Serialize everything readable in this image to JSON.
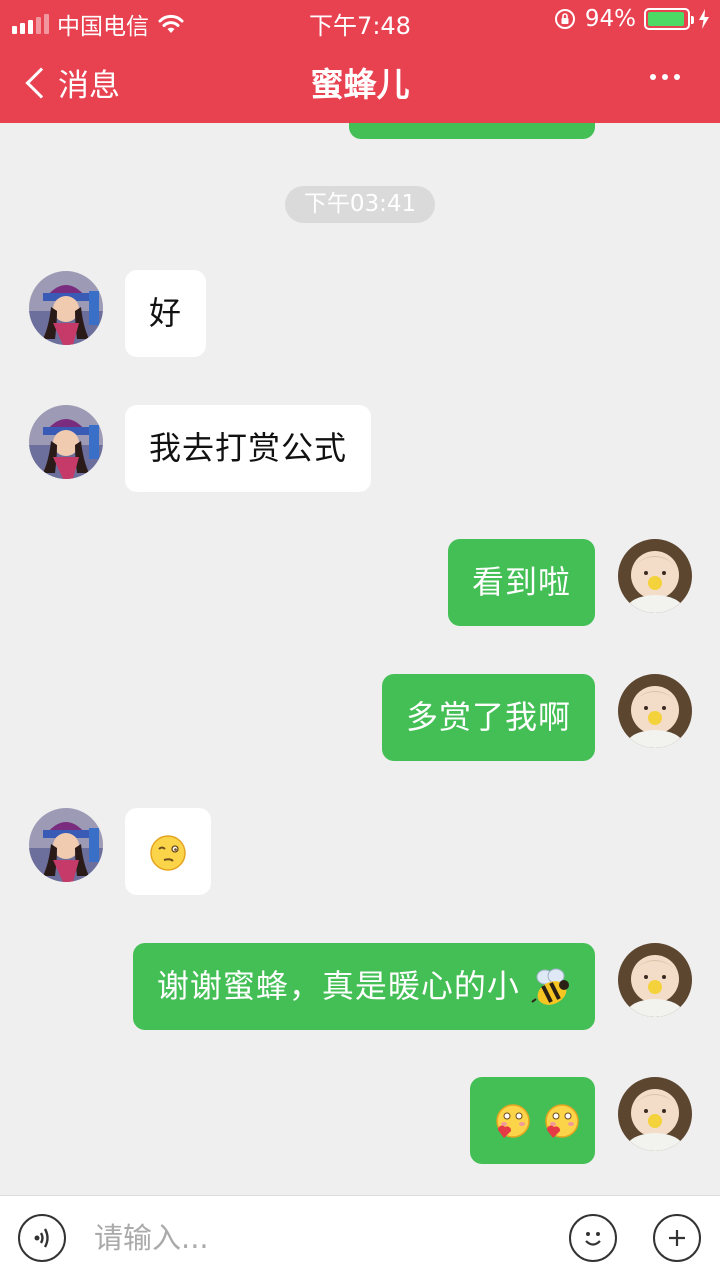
{
  "status_bar": {
    "carrier": "中国电信",
    "time": "下午7:48",
    "battery": "94%",
    "battery_level": 0.94
  },
  "nav": {
    "back_label": "消息",
    "title": "蜜蜂儿"
  },
  "chat": {
    "timestamp": "下午03:41",
    "messages": [
      {
        "side": "in",
        "text": "好"
      },
      {
        "side": "in",
        "text": "我去打赏公式"
      },
      {
        "side": "out",
        "text": "看到啦"
      },
      {
        "side": "out",
        "text": "多赏了我啊"
      },
      {
        "side": "in",
        "text": "",
        "emoji": "winking-face-emoji"
      },
      {
        "side": "out",
        "text": "谢谢蜜蜂，真是暖心的小",
        "emoji": "bee-emoji"
      },
      {
        "side": "out",
        "text": "",
        "emoji": "kissing-face-emoji"
      }
    ]
  },
  "input": {
    "placeholder": "请输入..."
  },
  "colors": {
    "header": "#e84251",
    "outgoing_bubble": "#43bf55",
    "incoming_bubble": "#ffffff",
    "background": "#efefef"
  }
}
